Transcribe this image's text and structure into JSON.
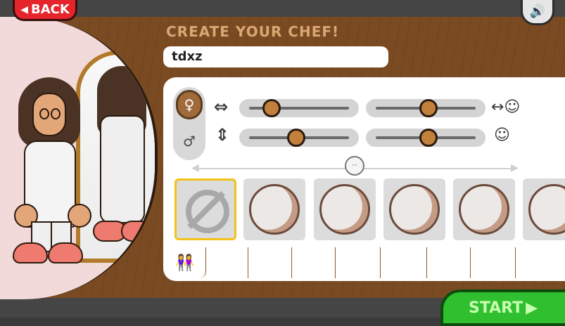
{
  "header": {
    "back_label": "BACK",
    "title": "CREATE YOUR CHEF!"
  },
  "chef_name": "tdxz",
  "icons": {
    "back": "triangle-left-icon",
    "sound": "speaker-icon",
    "width": "horizontal-arrows-icon",
    "height": "vertical-arrows-icon",
    "spacing": "face-horizontal-arrows-icon",
    "size": "face-circle-icon",
    "skin": "tone-face-icon",
    "start": "triangle-right-icon"
  },
  "gender": {
    "options": [
      "female",
      "male"
    ],
    "selected": "female"
  },
  "sliders": {
    "body_width": 0.23,
    "body_height": 0.47,
    "feature_spacing": 0.53,
    "feature_size": 0.53
  },
  "swatches": [
    {
      "kind": "none",
      "selected": true
    },
    {
      "kind": "plate",
      "selected": false
    },
    {
      "kind": "plate",
      "selected": false
    },
    {
      "kind": "plate",
      "selected": false
    },
    {
      "kind": "plate",
      "selected": false
    },
    {
      "kind": "plate",
      "selected": false
    }
  ],
  "tabs": [
    {
      "name": "body-tab",
      "icon": "two-people-icon",
      "active": true
    },
    {
      "name": "hair-front-tab",
      "icon": "short-hair-icon",
      "active": false
    },
    {
      "name": "hair-back-tab",
      "icon": "long-hair-icon",
      "active": false
    },
    {
      "name": "color-tab",
      "icon": "paint-bucket-icon",
      "active": false
    },
    {
      "name": "mouth-tab",
      "icon": "smile-icon",
      "active": false
    },
    {
      "name": "eyes-tab",
      "icon": "eyes-icon",
      "active": false
    },
    {
      "name": "eyebrows-tab",
      "icon": "eyebrow-icon",
      "active": false
    },
    {
      "name": "glasses-tab",
      "icon": "glasses-icon",
      "active": false
    }
  ],
  "start_label": "START",
  "colors": {
    "accent_wood": "#7a4b22",
    "title_tan": "#d9a773",
    "back_red": "#e5242b",
    "start_green": "#2fbf2f",
    "selected_gold": "#f2c316"
  }
}
